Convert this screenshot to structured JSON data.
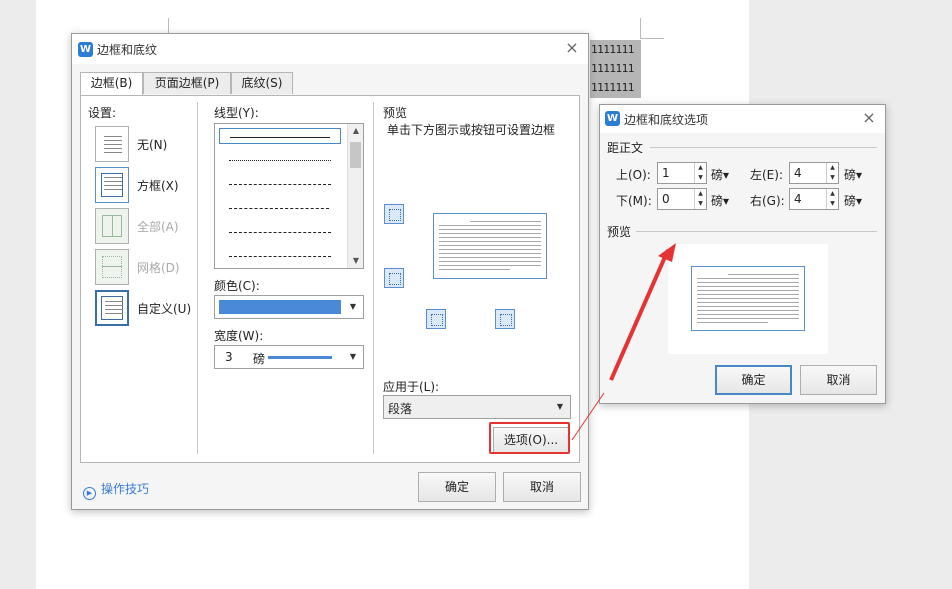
{
  "background": {
    "doc_lines": [
      "1111111",
      "1111111",
      "1111111"
    ]
  },
  "main_dialog": {
    "title": "边框和底纹",
    "logo": "W",
    "close": "×",
    "tabs": [
      {
        "label": "边框(B)"
      },
      {
        "label": "页面边框(P)"
      },
      {
        "label": "底纹(S)"
      }
    ],
    "settings_label": "设置:",
    "presets": [
      {
        "label": "无(N)",
        "icon": "none-border-icon",
        "enabled": true
      },
      {
        "label": "方框(X)",
        "icon": "box-border-icon",
        "enabled": true
      },
      {
        "label": "全部(A)",
        "icon": "all-borders-icon",
        "enabled": false
      },
      {
        "label": "网格(D)",
        "icon": "grid-border-icon",
        "enabled": false
      },
      {
        "label": "自定义(U)",
        "icon": "custom-border-icon",
        "enabled": true
      }
    ],
    "line_style_label": "线型(Y):",
    "line_styles": [
      "solid",
      "dotted",
      "dashed-small",
      "dashed",
      "dash-dot",
      "dash-dot-dot"
    ],
    "color_label": "颜色(C):",
    "color_value": "#4a89d8",
    "width_label": "宽度(W):",
    "width_value": "3",
    "width_unit": "磅",
    "preview_label": "预览",
    "preview_hint": "单击下方图示或按钮可设置边框",
    "apply_label": "应用于(L):",
    "apply_value": "段落",
    "options_button": "选项(O)...",
    "tips_link": "操作技巧",
    "ok_button": "确定",
    "cancel_button": "取消"
  },
  "options_dialog": {
    "title": "边框和底纹选项",
    "logo": "W",
    "close": "×",
    "distance_label": "距正文",
    "top_label": "上(O):",
    "top_value": "1",
    "bottom_label": "下(M):",
    "bottom_value": "0",
    "left_label": "左(E):",
    "left_value": "4",
    "right_label": "右(G):",
    "right_value": "4",
    "unit": "磅",
    "preview_label": "预览",
    "ok_button": "确定",
    "cancel_button": "取消"
  },
  "colors": {
    "accent": "#4a87c9",
    "annotation": "#e53333"
  }
}
